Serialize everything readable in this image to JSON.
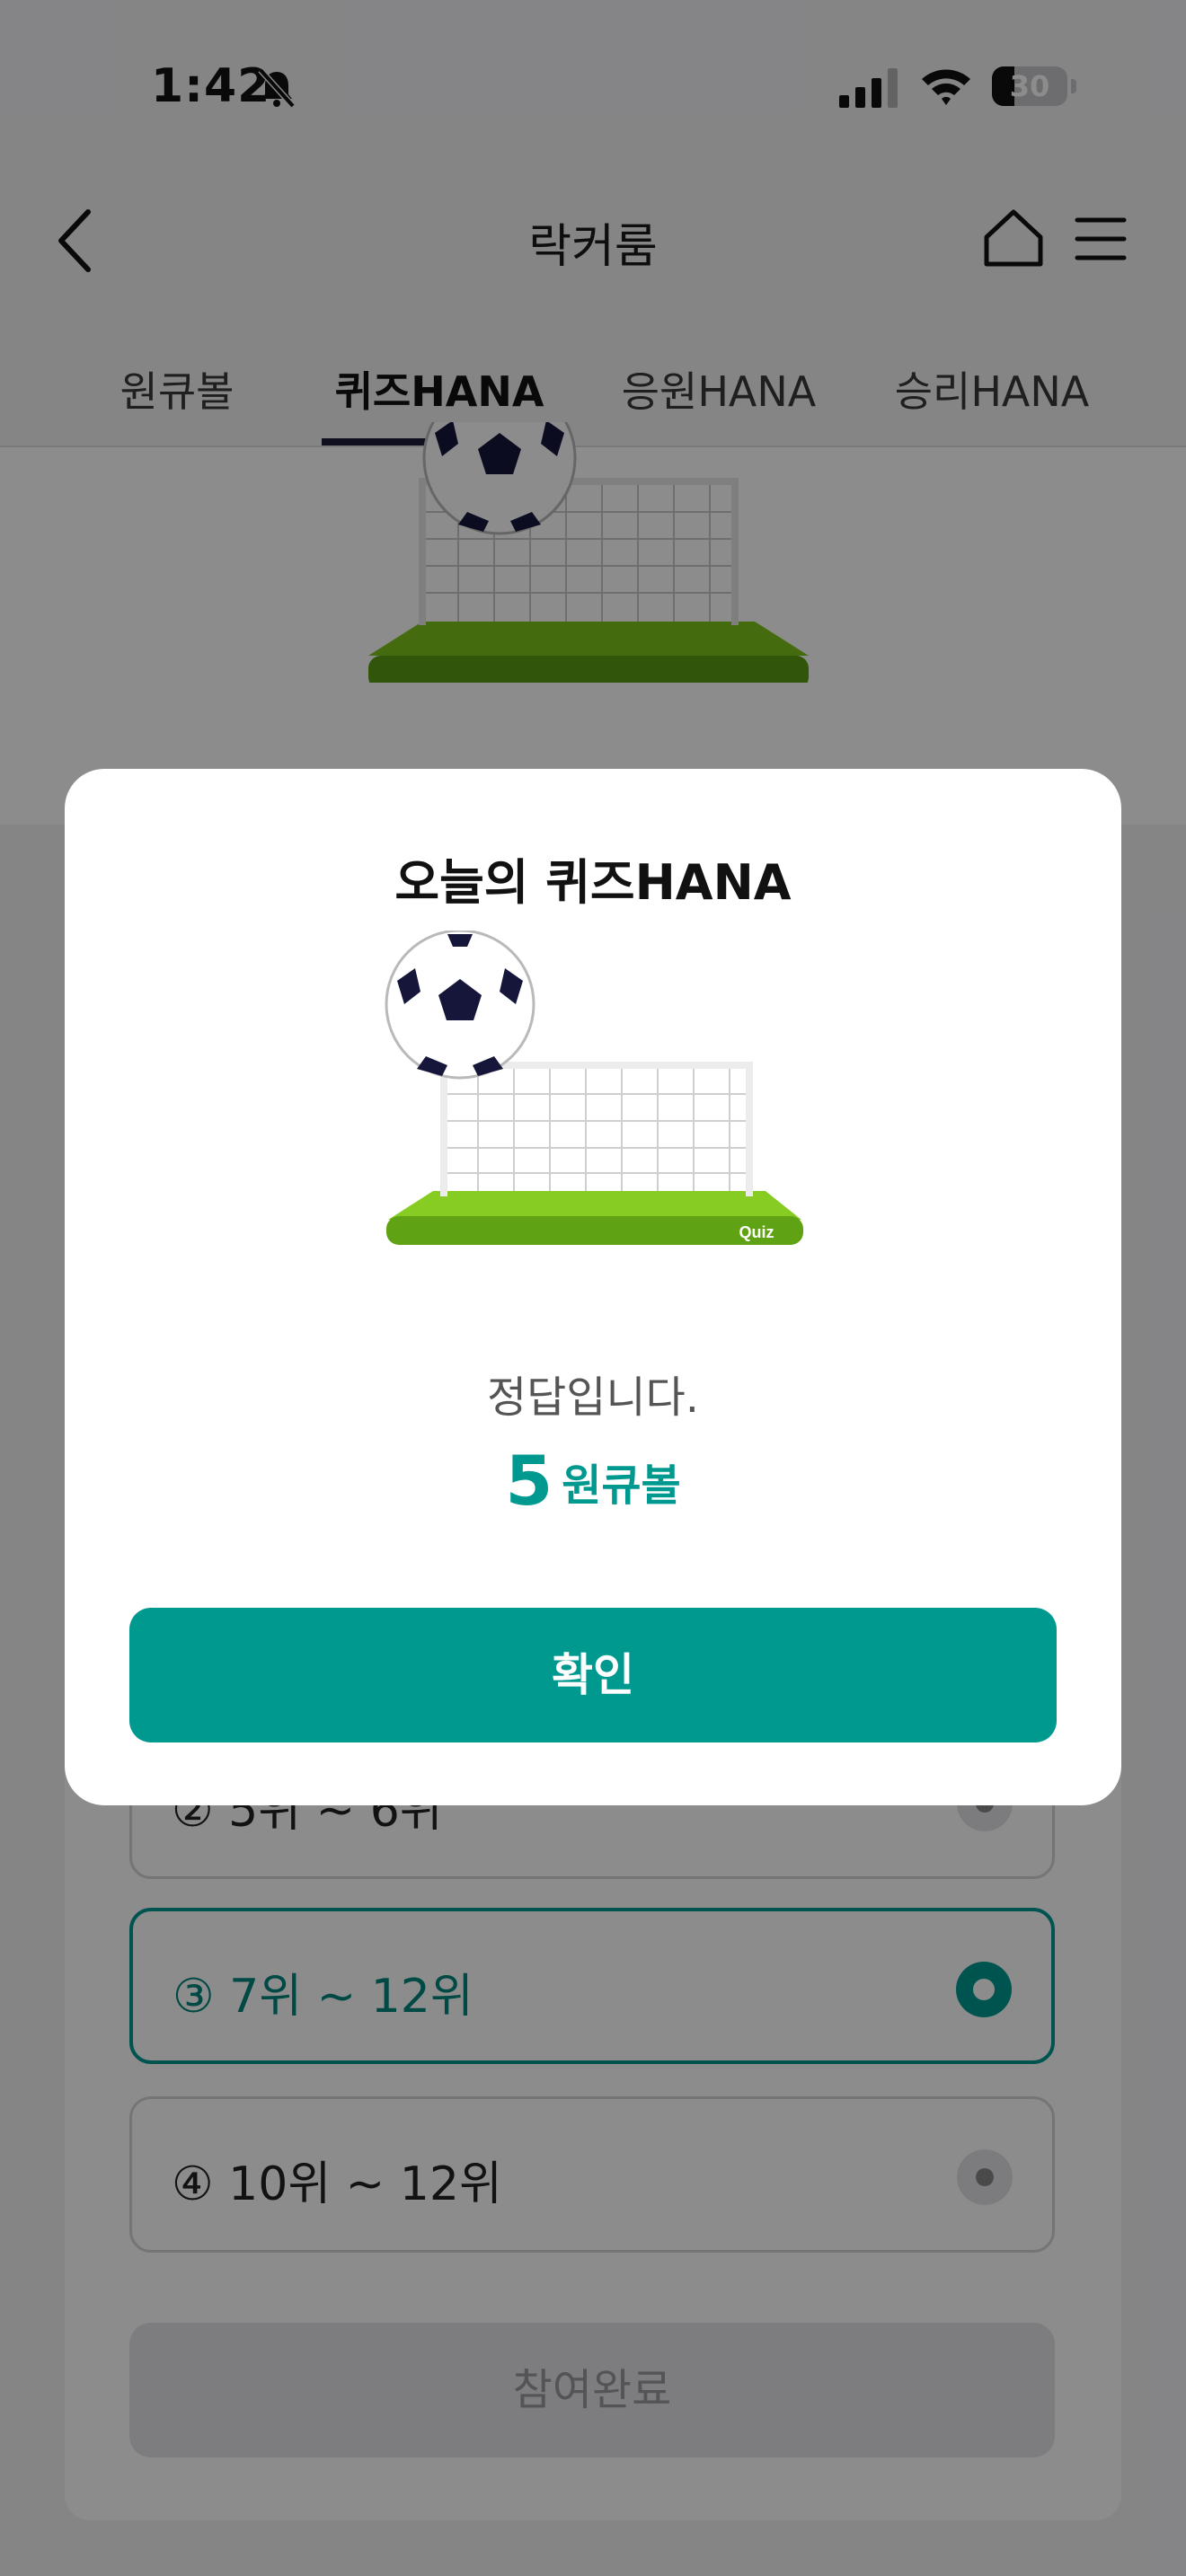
{
  "status_bar": {
    "time": "1:42",
    "battery": "30"
  },
  "header": {
    "title": "락커룸"
  },
  "tabs": [
    {
      "label": "원큐볼"
    },
    {
      "label": "퀴즈HANA"
    },
    {
      "label": "응원HANA"
    },
    {
      "label": "승리HANA"
    }
  ],
  "quiz": {
    "options": [
      {
        "label": "② 5위 ~ 6위"
      },
      {
        "label": "③ 7위 ~ 12위"
      },
      {
        "label": "④ 10위 ~ 12위"
      }
    ],
    "selected_index": 1,
    "submit_label": "참여완료"
  },
  "illustration": {
    "badge": "Quiz"
  },
  "modal": {
    "title": "오늘의 퀴즈HANA",
    "result": "정답입니다.",
    "reward_amount": "5",
    "reward_unit": "원큐볼",
    "confirm_label": "확인"
  },
  "colors": {
    "accent": "#009990",
    "tab_indicator": "#1c1c3a"
  }
}
